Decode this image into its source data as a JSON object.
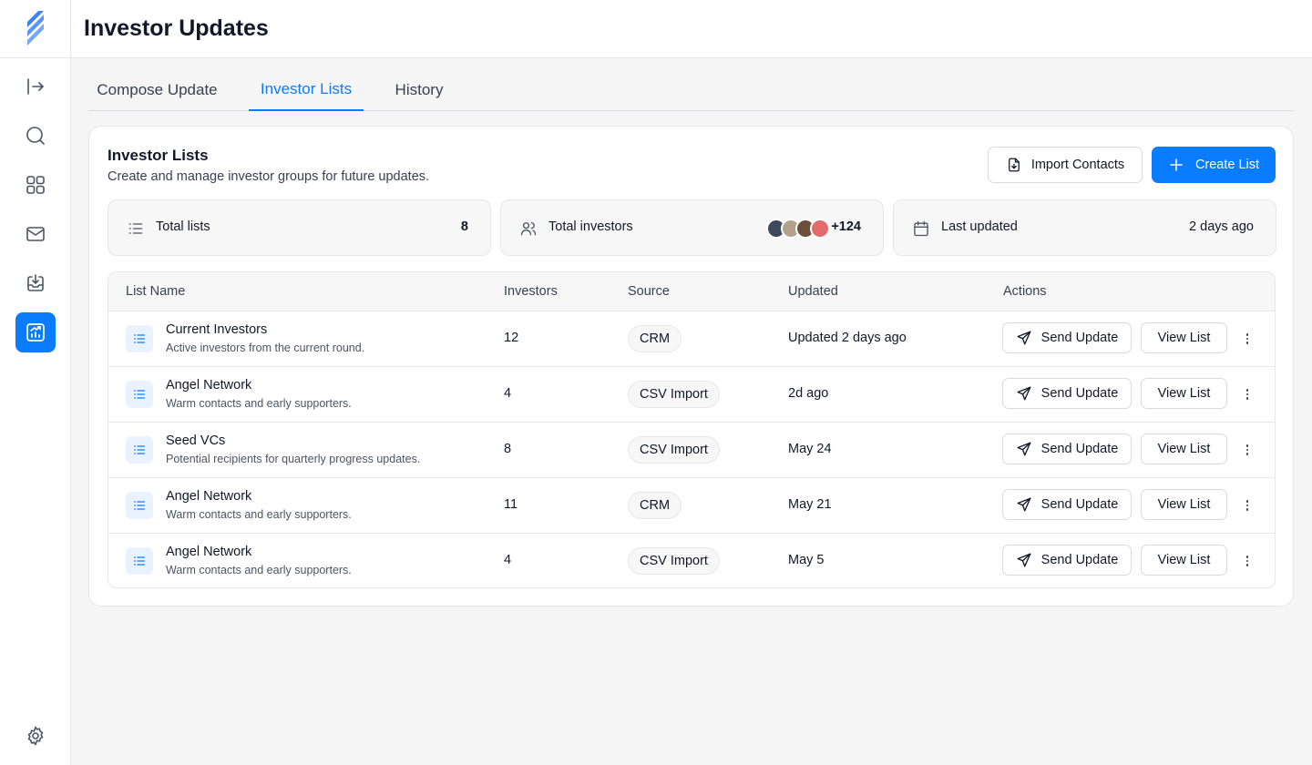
{
  "app": {
    "title": "Investor Updates"
  },
  "sidebar": {
    "items": [
      {
        "name": "collapse",
        "icon": "sidebar-expand-icon"
      },
      {
        "name": "search",
        "icon": "search-icon"
      },
      {
        "name": "dashboard",
        "icon": "grid-icon"
      },
      {
        "name": "mail",
        "icon": "mail-icon"
      },
      {
        "name": "inbox",
        "icon": "inbox-download-icon"
      },
      {
        "name": "investor-updates",
        "icon": "chart-trend-icon",
        "active": true
      }
    ],
    "settings_icon": "gear-icon"
  },
  "tabs": [
    {
      "label": "Compose Update",
      "active": false
    },
    {
      "label": "Investor Lists",
      "active": true
    },
    {
      "label": "History",
      "active": false
    }
  ],
  "card": {
    "title": "Investor Lists",
    "subtitle": "Create and manage investor groups for future updates.",
    "import_label": "Import Contacts",
    "create_label": "Create List"
  },
  "stats": {
    "total_lists": {
      "label": "Total lists",
      "value": "8"
    },
    "total_investors": {
      "label": "Total investors",
      "value": "+124"
    },
    "last_updated": {
      "label": "Last updated",
      "value": "2 days ago"
    }
  },
  "table": {
    "headers": [
      "List Name",
      "Investors",
      "Source",
      "Updated",
      "Actions"
    ],
    "send_label": "Send Update",
    "view_label": "View List",
    "rows": [
      {
        "name": "Current Investors",
        "desc": "Active investors from the current round.",
        "investors": "12",
        "source": "CRM",
        "updated": "Updated 2 days ago"
      },
      {
        "name": "Angel Network",
        "desc": "Warm contacts and early supporters.",
        "investors": "4",
        "source": "CSV Import",
        "updated": "2d ago"
      },
      {
        "name": "Seed VCs",
        "desc": "Potential recipients for quarterly progress updates.",
        "investors": "8",
        "source": "CSV Import",
        "updated": "May 24"
      },
      {
        "name": "Angel Network",
        "desc": "Warm contacts and early supporters.",
        "investors": "11",
        "source": "CRM",
        "updated": "May 21"
      },
      {
        "name": "Angel Network",
        "desc": "Warm contacts and early supporters.",
        "investors": "4",
        "source": "CSV Import",
        "updated": "May 5"
      }
    ]
  },
  "colors": {
    "accent": "#0a7cff",
    "background": "#f5f5f6",
    "border": "#e5e7eb"
  }
}
